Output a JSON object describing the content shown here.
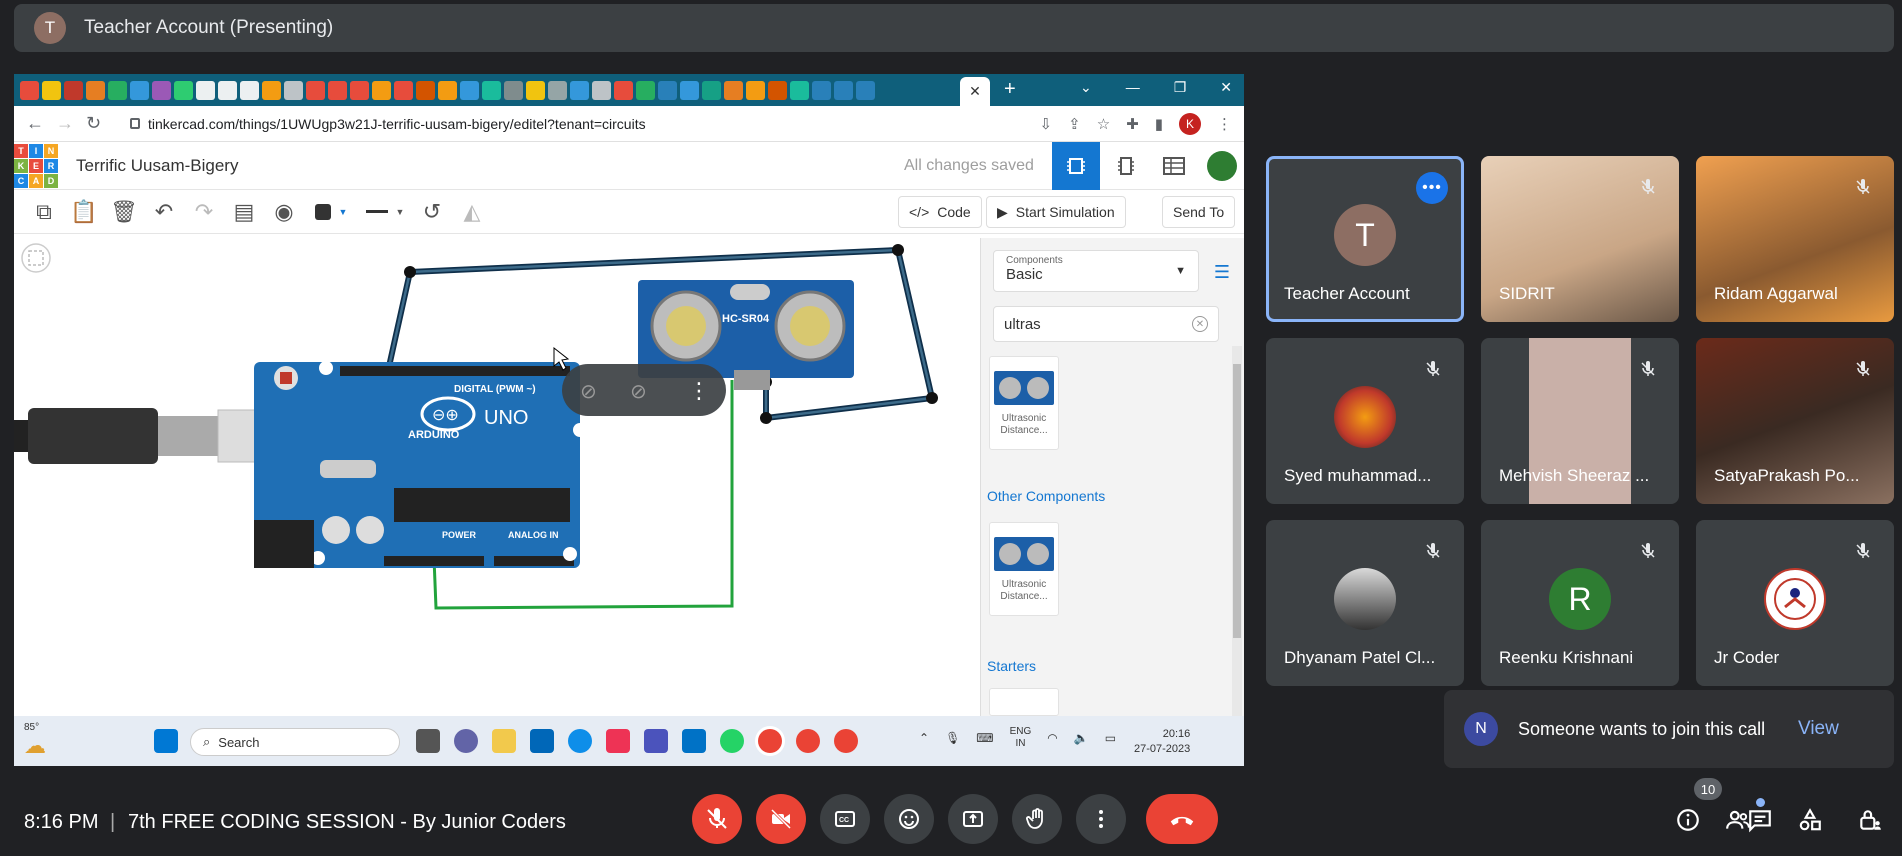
{
  "presenting": {
    "avatar_letter": "T",
    "title": "Teacher Account (Presenting)"
  },
  "browser": {
    "url": "tinkercad.com/things/1UWUgp3w21J-terrific-uusam-bigery/editel?tenant=circuits",
    "profile_letter": "K"
  },
  "tinkercad": {
    "logo_letters": [
      "T",
      "I",
      "N",
      "K",
      "E",
      "R",
      "C",
      "A",
      "D"
    ],
    "design_title": "Terrific Uusam-Bigery",
    "save_status": "All changes saved",
    "code_label": "Code",
    "simulate_label": "Start Simulation",
    "send_label": "Send To",
    "components": {
      "select_caption": "Components",
      "select_value": "Basic",
      "search_value": "ultras",
      "item_label": "Ultrasonic Distance...",
      "other_title": "Other Components",
      "starters_title": "Starters"
    },
    "board": {
      "sensor": "HC-SR04",
      "uno": "UNO",
      "brand": "ARDUINO",
      "digital": "DIGITAL (PWM ~)",
      "power": "POWER",
      "analog": "ANALOG IN"
    }
  },
  "taskbar": {
    "weather": "85°",
    "search_placeholder": "Search",
    "lang_top": "ENG",
    "lang_bottom": "IN",
    "time": "20:16",
    "date": "27-07-2023"
  },
  "participants": [
    {
      "name": "Teacher Account",
      "avatar": "T"
    },
    {
      "name": "SIDRIT"
    },
    {
      "name": "Ridam Aggarwal"
    },
    {
      "name": "Syed muhammad..."
    },
    {
      "name": "Mehvish Sheeraz ..."
    },
    {
      "name": "SatyaPrakash Po..."
    },
    {
      "name": "Dhyanam Patel Cl..."
    },
    {
      "name": "Reenku Krishnani",
      "avatar": "R"
    },
    {
      "name": "Jr Coder"
    }
  ],
  "notification": {
    "avatar_letter": "N",
    "text": "Someone wants to join this call",
    "action": "View"
  },
  "meeting": {
    "time": "8:16 PM",
    "separator": "|",
    "title": "7th FREE CODING SESSION - By Junior Coders",
    "people_count": "10"
  },
  "colors": {
    "accent": "#8ab4f8",
    "end_call": "#ea4335",
    "tinkercad_blue": "#1477d1",
    "arduino_blue": "#1f6fb5"
  }
}
